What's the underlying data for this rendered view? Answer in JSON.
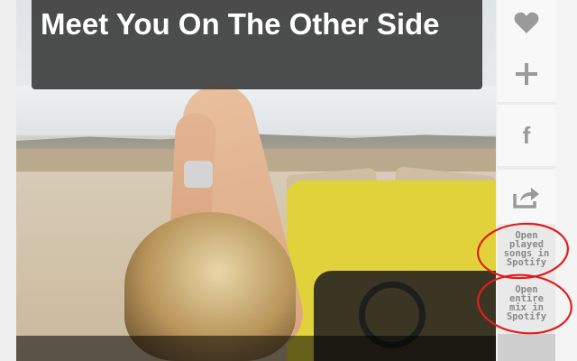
{
  "track": {
    "title": "Meet You On The Other Side"
  },
  "sidebar": {
    "like": {
      "icon": "heart-icon"
    },
    "add": {
      "icon": "plus-icon"
    },
    "facebook": {
      "icon": "facebook-icon",
      "label": "f"
    },
    "share": {
      "icon": "share-icon"
    },
    "open_played": {
      "label": "Open played songs in Spotify"
    },
    "open_mix": {
      "label": "Open entire mix in Spotify"
    }
  },
  "colors": {
    "title_bg": "#404040",
    "icon": "#9a9a9a",
    "annotation": "#e01e1e"
  }
}
